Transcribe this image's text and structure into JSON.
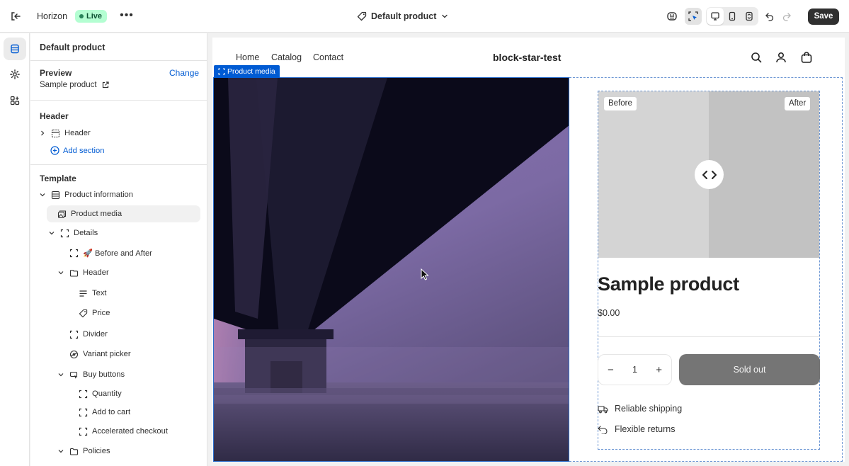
{
  "topbar": {
    "theme_name": "Horizon",
    "live_label": "Live",
    "more_label": "•••",
    "template_name": "Default product",
    "save_label": "Save"
  },
  "sidebar": {
    "title": "Default product",
    "preview_heading": "Preview",
    "preview_change": "Change",
    "preview_product": "Sample product",
    "header_heading": "Header",
    "header_item": "Header",
    "add_section": "Add section",
    "template_heading": "Template",
    "tree": [
      {
        "label": "Product information"
      },
      {
        "label": "Product media"
      },
      {
        "label": "Details"
      },
      {
        "label": "🚀 Before and After"
      },
      {
        "label": "Header"
      },
      {
        "label": "Text"
      },
      {
        "label": "Price"
      },
      {
        "label": "Divider"
      },
      {
        "label": "Variant picker"
      },
      {
        "label": "Buy buttons"
      },
      {
        "label": "Quantity"
      },
      {
        "label": "Add to cart"
      },
      {
        "label": "Accelerated checkout"
      },
      {
        "label": "Policies"
      }
    ]
  },
  "storefront": {
    "nav": [
      "Home",
      "Catalog",
      "Contact"
    ],
    "store_name": "block-star-test",
    "media_tag": "Product media",
    "before_label": "Before",
    "after_label": "After",
    "product_title": "Sample product",
    "price": "$0.00",
    "quantity": "1",
    "qty_minus": "−",
    "qty_plus": "+",
    "sold_out": "Sold out",
    "perks": [
      "Reliable shipping",
      "Flexible returns"
    ]
  },
  "colors": {
    "accent_blue": "#005bd3",
    "live_badge_bg": "#b4fed2",
    "save_button_bg": "#303030",
    "sold_out_bg": "#757575"
  }
}
